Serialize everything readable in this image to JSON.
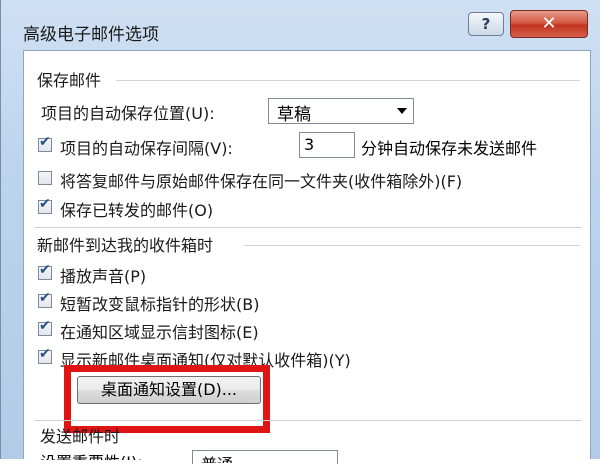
{
  "dialog": {
    "title": "高级电子邮件选项",
    "help_label": "?",
    "close_label": "✕"
  },
  "save_group": {
    "label": "保存邮件",
    "autosave_location_label": "项目的自动保存位置(U):",
    "autosave_location_value": "草稿",
    "autosave_interval_label": "项目的自动保存间隔(V):",
    "autosave_interval_value": "3",
    "autosave_interval_suffix": "分钟自动保存未发送邮件",
    "save_replies_label": "将答复邮件与原始邮件保存在同一文件夹(收件箱除外)(F)",
    "save_forwarded_label": "保存已转发的邮件(O)",
    "autosave_interval_checked": true,
    "save_replies_checked": false,
    "save_forwarded_checked": true
  },
  "arrival_group": {
    "label": "新邮件到达我的收件箱时",
    "play_sound_label": "播放声音(P)",
    "change_pointer_label": "短暂改变鼠标指针的形状(B)",
    "show_envelope_label": "在通知区域显示信封图标(E)",
    "show_desktop_alert_label": "显示新邮件桌面通知(仅对默认收件箱)(Y)",
    "play_sound_checked": true,
    "change_pointer_checked": true,
    "show_envelope_checked": true,
    "show_desktop_alert_checked": true,
    "desktop_alert_settings_label": "桌面通知设置(D)..."
  },
  "send_group": {
    "label": "发送邮件时",
    "partial_row_label": "设置重要性(I):",
    "partial_row_value": "普通"
  },
  "colors": {
    "highlight": "#e01414",
    "close_button": "#c0341f",
    "checkmark": "#24508a"
  }
}
